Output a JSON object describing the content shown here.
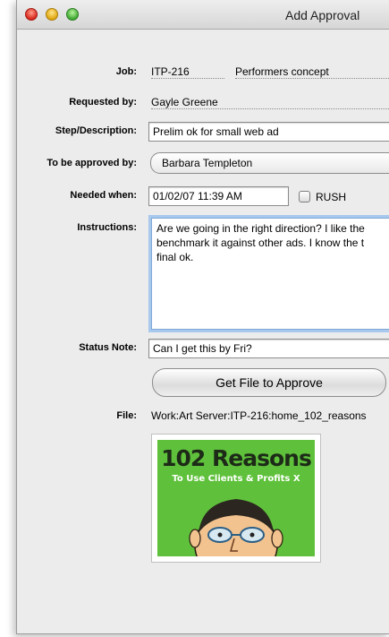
{
  "window": {
    "title": "Add Approval"
  },
  "form": {
    "job_label": "Job:",
    "job_number": "ITP-216",
    "job_name": "Performers concept",
    "requested_by_label": "Requested by:",
    "requested_by": "Gayle Greene",
    "step_label": "Step/Description:",
    "step_value": "Prelim ok for small web ad",
    "approver_label": "To be approved by:",
    "approver_value": "Barbara Templeton",
    "needed_label": "Needed when:",
    "needed_value": "01/02/07 11:39 AM",
    "rush_label": "RUSH",
    "rush_checked": false,
    "instructions_label": "Instructions:",
    "instructions_value": "Are we going in the right direction? I like the\nbenchmark it against other ads. I know the t\nfinal ok.",
    "status_label": "Status Note:",
    "status_value": "Can I get this by Fri?",
    "get_file_button": "Get File to Approve",
    "file_label": "File:",
    "file_path": "Work:Art Server:ITP-216:home_102_reasons"
  },
  "preview": {
    "title": "102 Reasons",
    "subtitle": "To Use Clients & Profits X",
    "background": "#5fc13b"
  }
}
